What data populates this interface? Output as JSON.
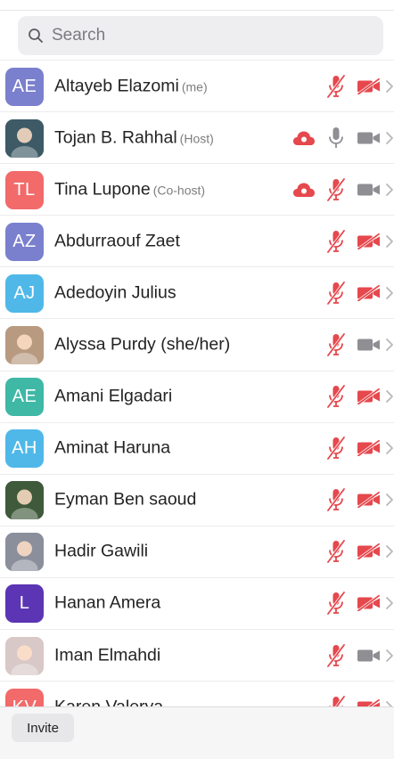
{
  "search": {
    "placeholder": "Search",
    "value": ""
  },
  "participants": [
    {
      "name": "Altayeb Elazomi",
      "role": "(me)",
      "initials": "AE",
      "avatar_color": "#7a80cd",
      "photo": false,
      "recording": false,
      "mic": "muted",
      "video": "off"
    },
    {
      "name": "Tojan B. Rahhal",
      "role": "(Host)",
      "initials": "",
      "avatar_color": "#3d5a66",
      "photo": true,
      "recording": true,
      "mic": "on",
      "video": "on"
    },
    {
      "name": "Tina Lupone",
      "role": "(Co-host)",
      "initials": "TL",
      "avatar_color": "#f26a6a",
      "photo": false,
      "recording": true,
      "mic": "muted",
      "video": "on"
    },
    {
      "name": "Abdurraouf Zaet",
      "role": "",
      "initials": "AZ",
      "avatar_color": "#7a80cd",
      "photo": false,
      "recording": false,
      "mic": "muted",
      "video": "off"
    },
    {
      "name": "Adedoyin Julius",
      "role": "",
      "initials": "AJ",
      "avatar_color": "#4fb8e8",
      "photo": false,
      "recording": false,
      "mic": "muted",
      "video": "off"
    },
    {
      "name": "Alyssa Purdy (she/her)",
      "role": "",
      "initials": "",
      "avatar_color": "#b89a80",
      "photo": true,
      "recording": false,
      "mic": "muted",
      "video": "on"
    },
    {
      "name": "Amani Elgadari",
      "role": "",
      "initials": "AE",
      "avatar_color": "#3fb8a6",
      "photo": false,
      "recording": false,
      "mic": "muted",
      "video": "off"
    },
    {
      "name": "Aminat Haruna",
      "role": "",
      "initials": "AH",
      "avatar_color": "#4fb8e8",
      "photo": false,
      "recording": false,
      "mic": "muted",
      "video": "off"
    },
    {
      "name": "Eyman Ben saoud",
      "role": "",
      "initials": "",
      "avatar_color": "#3e5a3a",
      "photo": true,
      "recording": false,
      "mic": "muted",
      "video": "off"
    },
    {
      "name": "Hadir Gawili",
      "role": "",
      "initials": "",
      "avatar_color": "#8b8f9c",
      "photo": true,
      "recording": false,
      "mic": "muted",
      "video": "off"
    },
    {
      "name": "Hanan Amera",
      "role": "",
      "initials": "L",
      "avatar_color": "#5b35b3",
      "photo": false,
      "recording": false,
      "mic": "muted",
      "video": "off"
    },
    {
      "name": "Iman Elmahdi",
      "role": "",
      "initials": "",
      "avatar_color": "#d9c8c8",
      "photo": true,
      "recording": false,
      "mic": "muted",
      "video": "on"
    },
    {
      "name": "Karen Valerya",
      "role": "",
      "initials": "KV",
      "avatar_color": "#f26a6a",
      "photo": false,
      "recording": false,
      "mic": "muted",
      "video": "off"
    }
  ],
  "colors": {
    "muted_red": "#e5484d",
    "icon_gray": "#8e8e93",
    "chevron": "#b8b8bd"
  },
  "icons": {
    "search": "search-icon",
    "recording": "cloud-recording-icon",
    "mic_muted": "mic-muted-icon",
    "mic_on": "mic-icon",
    "video_off": "video-off-icon",
    "video_on": "video-icon",
    "chevron": "chevron-right-icon"
  },
  "footer": {
    "invite_label": "Invite"
  }
}
